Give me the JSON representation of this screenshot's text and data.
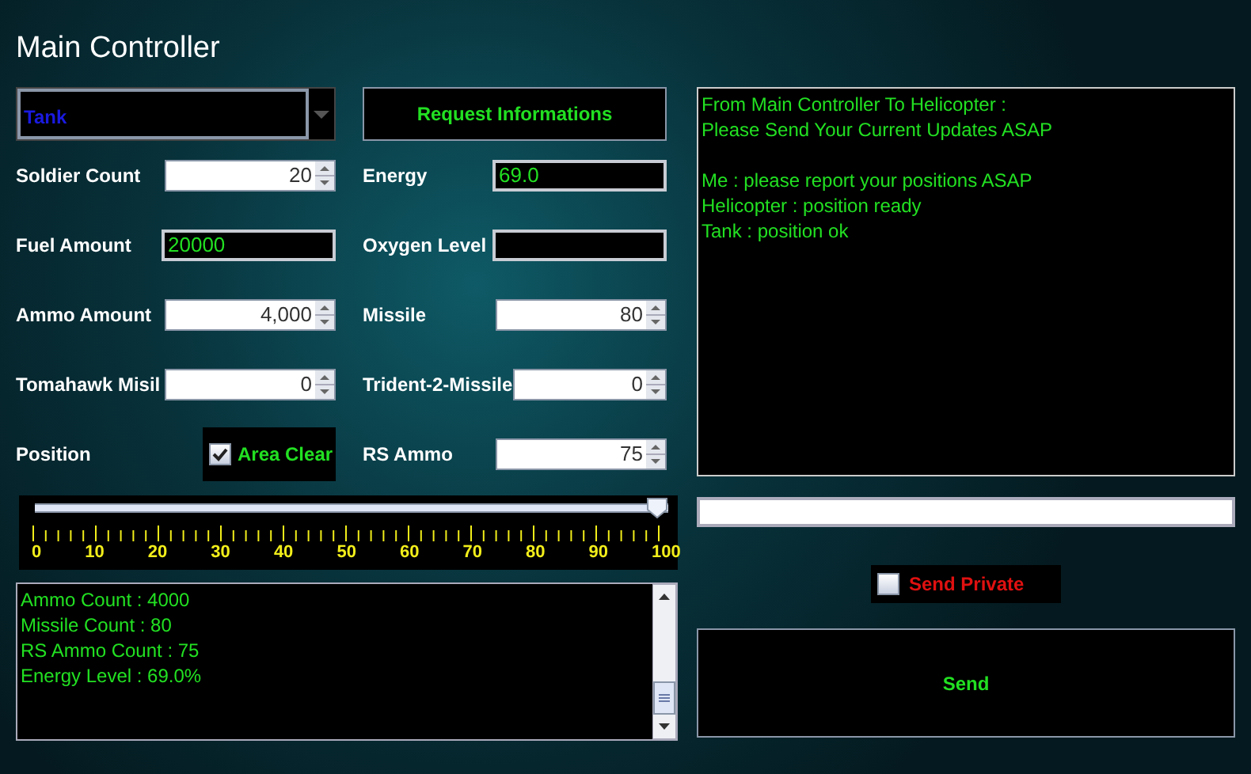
{
  "window": {
    "title": "Main Controller"
  },
  "vehicle_select": {
    "value": "Tank"
  },
  "request_button": {
    "label": "Request Informations"
  },
  "left_fields": [
    {
      "label": "Soldier Count",
      "kind": "spinner",
      "value": "20"
    },
    {
      "label": "Fuel Amount",
      "kind": "text",
      "value": "20000"
    },
    {
      "label": "Ammo Amount",
      "kind": "spinner",
      "value": "4,000"
    },
    {
      "label": "Tomahawk Misil",
      "kind": "spinner",
      "value": "0"
    },
    {
      "label": "Position",
      "kind": "checkbox",
      "text": "Area Clear",
      "checked": true
    }
  ],
  "right_fields": [
    {
      "label": "Energy",
      "kind": "text",
      "value": "69.0"
    },
    {
      "label": "Oxygen Level",
      "kind": "text"
    },
    {
      "label": "Missile",
      "kind": "spinner",
      "value": "80"
    },
    {
      "label": "Trident-2-Missile",
      "kind": "spinner",
      "value": "0"
    },
    {
      "label": "RS Ammo",
      "kind": "spinner",
      "value": "75"
    }
  ],
  "slider": {
    "level": 1.0,
    "tick_labels": [
      "0",
      "10",
      "20",
      "30",
      "40",
      "50",
      "60",
      "70",
      "80",
      "90",
      "100"
    ]
  },
  "log": {
    "lines": [
      "Ammo Count : 4000",
      "Missile Count : 80",
      "RS Ammo Count : 75",
      "Energy Level : 69.0%"
    ]
  },
  "chat": {
    "header": [
      "From Main Controller To Helicopter :",
      "Please Send Your Current Updates ASAP"
    ],
    "messages": [
      "Me : please report your positions ASAP",
      "Helicopter : position ready",
      "Tank : position ok"
    ]
  },
  "send_private": {
    "label": "Send Private",
    "checked": false
  },
  "send_button": {
    "label": "Send"
  }
}
